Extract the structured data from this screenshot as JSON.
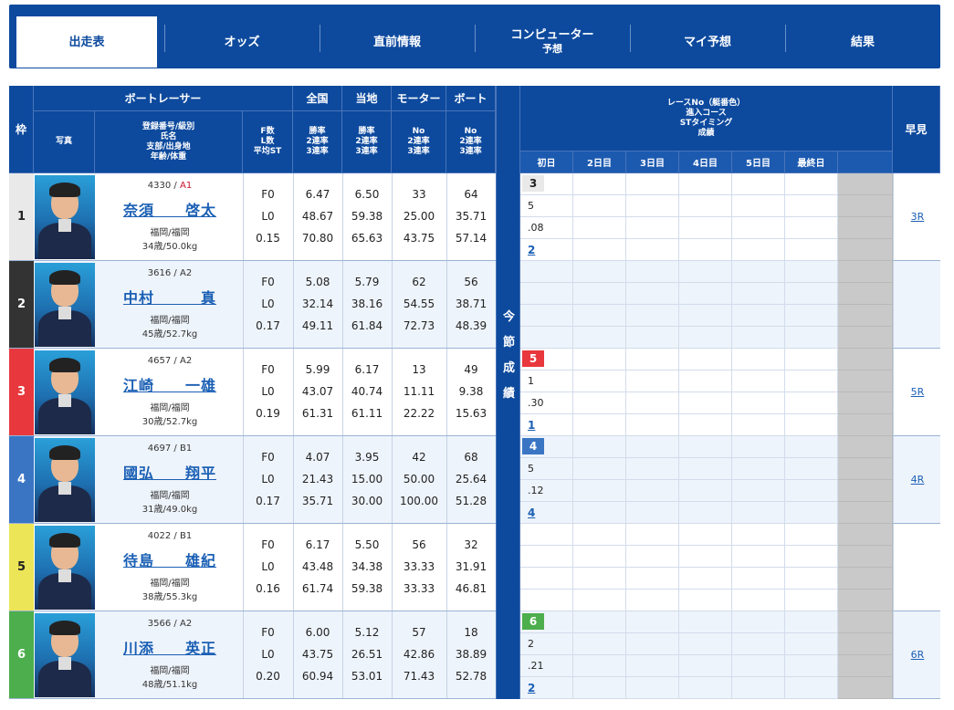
{
  "tabs": [
    {
      "label": "出走表",
      "sub": "",
      "active": true
    },
    {
      "label": "オッズ",
      "sub": "",
      "active": false
    },
    {
      "label": "直前情報",
      "sub": "",
      "active": false
    },
    {
      "label": "コンピューター",
      "sub": "予想",
      "active": false
    },
    {
      "label": "マイ予想",
      "sub": "",
      "active": false
    },
    {
      "label": "結果",
      "sub": "",
      "active": false
    }
  ],
  "header": {
    "waku": "枠",
    "boatracer": "ボートレーサー",
    "photo": "写真",
    "racer_info": [
      "登録番号/級別",
      "氏名",
      "支部/出身地",
      "年齢/体重"
    ],
    "fl": [
      "F数",
      "L数",
      "平均ST"
    ],
    "national": "全国",
    "local": "当地",
    "motor": "モーター",
    "boat": "ボート",
    "rate_rows": [
      "勝率",
      "2連率",
      "3連率"
    ],
    "no_rows": [
      "No",
      "2連率",
      "3連率"
    ],
    "race_info": [
      "レースNo（艇番色）",
      "進入コース",
      "STタイミング",
      "成績"
    ],
    "days": [
      "初日",
      "2日目",
      "3日目",
      "4日目",
      "5日目",
      "最終日"
    ],
    "hayami": "早見",
    "band": "今節成績"
  },
  "colors": {
    "waku": [
      "#e9e9e9",
      "#333333",
      "#e8383d",
      "#3a75c4",
      "#ece557",
      "#4cae4c"
    ],
    "waku_text": [
      "#222222",
      "#ffffff",
      "#ffffff",
      "#ffffff",
      "#222222",
      "#ffffff"
    ]
  },
  "racers": [
    {
      "reg": "4330",
      "cls": "A1",
      "name": "奈須　　啓太",
      "area": "福岡/福岡",
      "age": "34歳/50.0kg",
      "f": "F0",
      "l": "L0",
      "st": "0.15",
      "nat": [
        "6.47",
        "48.67",
        "70.80"
      ],
      "loc": [
        "6.50",
        "59.38",
        "65.63"
      ],
      "motor": [
        "33",
        "25.00",
        "43.75"
      ],
      "boat": [
        "64",
        "35.71",
        "57.14"
      ],
      "race": {
        "no": "3",
        "course": "5",
        "st": ".08",
        "result": "2"
      },
      "hayami": "3R"
    },
    {
      "reg": "3616",
      "cls": "A2",
      "name": "中村　　　真",
      "area": "福岡/福岡",
      "age": "45歳/52.7kg",
      "f": "F0",
      "l": "L0",
      "st": "0.17",
      "nat": [
        "5.08",
        "32.14",
        "49.11"
      ],
      "loc": [
        "5.79",
        "38.16",
        "61.84"
      ],
      "motor": [
        "62",
        "54.55",
        "72.73"
      ],
      "boat": [
        "56",
        "38.71",
        "48.39"
      ],
      "race": null,
      "hayami": ""
    },
    {
      "reg": "4657",
      "cls": "A2",
      "name": "江崎　　一雄",
      "area": "福岡/福岡",
      "age": "30歳/52.7kg",
      "f": "F0",
      "l": "L0",
      "st": "0.19",
      "nat": [
        "5.99",
        "43.07",
        "61.31"
      ],
      "loc": [
        "6.17",
        "40.74",
        "61.11"
      ],
      "motor": [
        "13",
        "11.11",
        "22.22"
      ],
      "boat": [
        "49",
        "9.38",
        "15.63"
      ],
      "race": {
        "no": "5",
        "course": "1",
        "st": ".30",
        "result": "1"
      },
      "hayami": "5R"
    },
    {
      "reg": "4697",
      "cls": "B1",
      "name": "國弘　　翔平",
      "area": "福岡/福岡",
      "age": "31歳/49.0kg",
      "f": "F0",
      "l": "L0",
      "st": "0.17",
      "nat": [
        "4.07",
        "21.43",
        "35.71"
      ],
      "loc": [
        "3.95",
        "15.00",
        "30.00"
      ],
      "motor": [
        "42",
        "50.00",
        "100.00"
      ],
      "boat": [
        "68",
        "25.64",
        "51.28"
      ],
      "race": {
        "no": "4",
        "course": "5",
        "st": ".12",
        "result": "4"
      },
      "hayami": "4R"
    },
    {
      "reg": "4022",
      "cls": "B1",
      "name": "待島　　雄紀",
      "area": "福岡/福岡",
      "age": "38歳/55.3kg",
      "f": "F0",
      "l": "L0",
      "st": "0.16",
      "nat": [
        "6.17",
        "43.48",
        "61.74"
      ],
      "loc": [
        "5.50",
        "34.38",
        "59.38"
      ],
      "motor": [
        "56",
        "33.33",
        "33.33"
      ],
      "boat": [
        "32",
        "31.91",
        "46.81"
      ],
      "race": null,
      "hayami": ""
    },
    {
      "reg": "3566",
      "cls": "A2",
      "name": "川添　　英正",
      "area": "福岡/福岡",
      "age": "48歳/51.1kg",
      "f": "F0",
      "l": "L0",
      "st": "0.20",
      "nat": [
        "6.00",
        "43.75",
        "60.94"
      ],
      "loc": [
        "5.12",
        "26.51",
        "53.01"
      ],
      "motor": [
        "57",
        "42.86",
        "71.43"
      ],
      "boat": [
        "18",
        "38.89",
        "52.78"
      ],
      "race": {
        "no": "6",
        "course": "2",
        "st": ".21",
        "result": "2"
      },
      "hayami": "6R"
    }
  ]
}
